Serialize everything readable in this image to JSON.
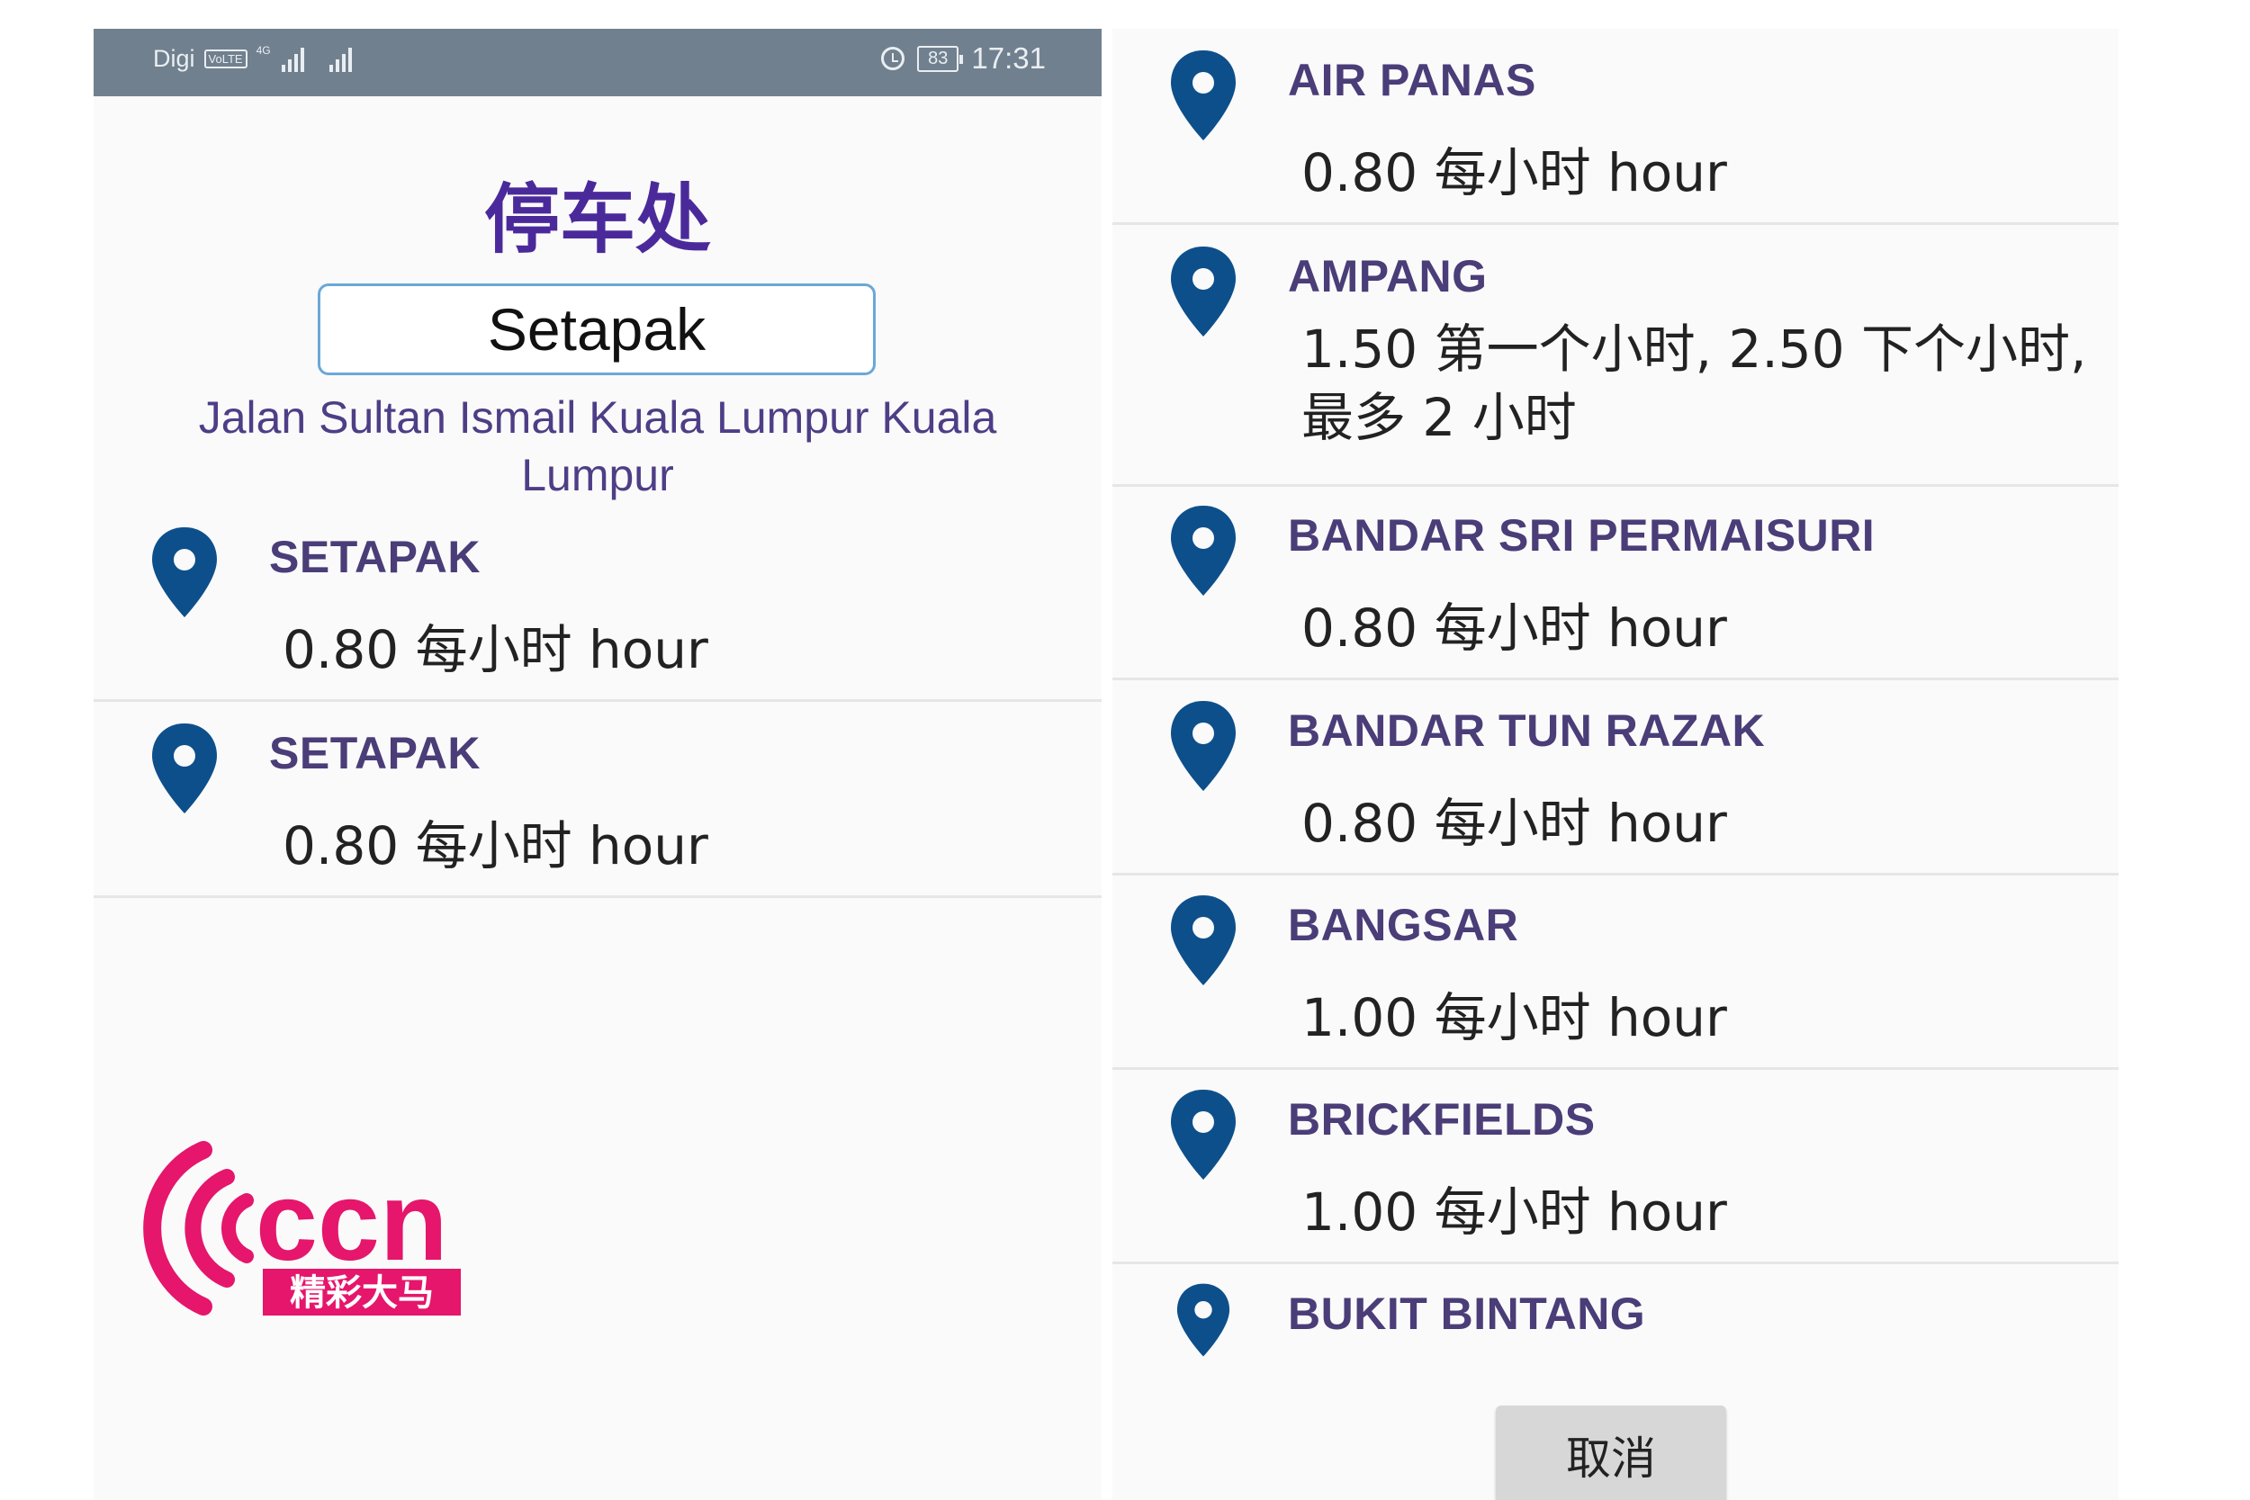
{
  "status_bar": {
    "carrier": "Digi",
    "volte": "VoLTE",
    "network": "4G",
    "battery": "83",
    "time": "17:31"
  },
  "left_panel": {
    "title": "停车处",
    "search_value": "Setapak",
    "address": "Jalan Sultan Ismail Kuala Lumpur Kuala Lumpur",
    "results": [
      {
        "name": "SETAPAK",
        "rate": "0.80 每小时 hour"
      },
      {
        "name": "SETAPAK",
        "rate": "0.80 每小时 hour"
      }
    ]
  },
  "right_panel": {
    "results": [
      {
        "name": "AIR PANAS",
        "rate": "0.80 每小时 hour"
      },
      {
        "name": "AMPANG",
        "rate": "1.50 第一个小时, 2.50 下个小时, 最多 2 小时"
      },
      {
        "name": "BANDAR SRI PERMAISURI",
        "rate": "0.80 每小时 hour"
      },
      {
        "name": "BANDAR TUN RAZAK",
        "rate": "0.80 每小时 hour"
      },
      {
        "name": "BANGSAR",
        "rate": "1.00 每小时 hour"
      },
      {
        "name": "BRICKFIELDS",
        "rate": "1.00 每小时 hour"
      },
      {
        "name": "BUKIT BINTANG",
        "rate": ""
      }
    ],
    "cancel_label": "取消"
  },
  "logo": {
    "text": "ccn",
    "tagline": "精彩大马"
  },
  "icons": {
    "location": "location-pin-icon"
  },
  "colors": {
    "title": "#4a2a9b",
    "name": "#4a3d78",
    "pin": "#0d4f8b",
    "logo": "#e5166b"
  }
}
